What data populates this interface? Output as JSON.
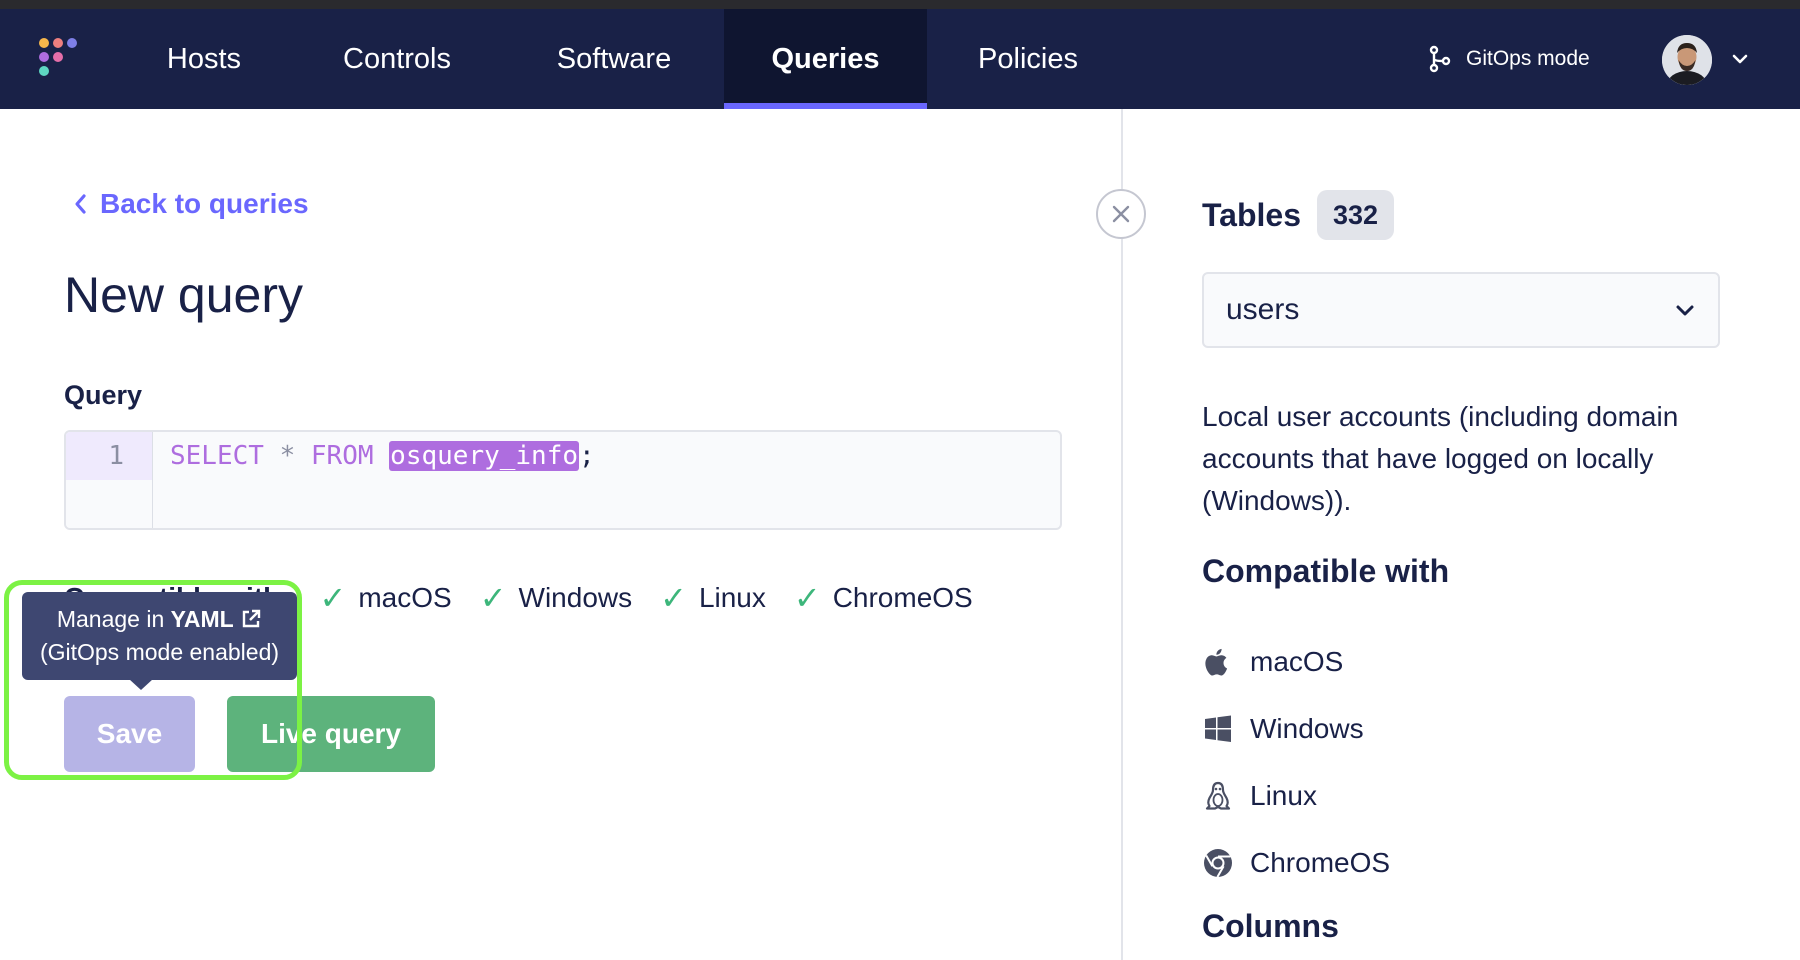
{
  "nav": {
    "items": [
      {
        "label": "Hosts",
        "active": false
      },
      {
        "label": "Controls",
        "active": false
      },
      {
        "label": "Software",
        "active": false
      },
      {
        "label": "Queries",
        "active": true
      },
      {
        "label": "Policies",
        "active": false
      }
    ],
    "gitops_label": "GitOps mode",
    "accent_color": "#6a67fe"
  },
  "main": {
    "back_label": "Back to queries",
    "title": "New query",
    "query_label": "Query",
    "editor": {
      "line_number": "1",
      "code_keyword_1": "SELECT",
      "code_op": "*",
      "code_keyword_2": "FROM",
      "code_selected": "osquery_info",
      "code_end": ";"
    },
    "compatible_title": "Compatible with:",
    "compatible": [
      "macOS",
      "Windows",
      "Linux",
      "ChromeOS"
    ],
    "save_label": "Save",
    "live_query_label": "Live query",
    "tooltip": {
      "line1_prefix": "Manage in",
      "line1_strong": "YAML",
      "line2": "(GitOps mode enabled)"
    }
  },
  "sidebar": {
    "tables_title": "Tables",
    "tables_count": "332",
    "selected_table": "users",
    "description": "Local user accounts (including domain accounts that have logged on locally (Windows)).",
    "compatible_heading": "Compatible with",
    "platforms": [
      {
        "label": "macOS",
        "icon": "apple-icon"
      },
      {
        "label": "Windows",
        "icon": "windows-icon"
      },
      {
        "label": "Linux",
        "icon": "linux-icon"
      },
      {
        "label": "ChromeOS",
        "icon": "chrome-icon"
      }
    ],
    "columns_heading": "Columns"
  }
}
